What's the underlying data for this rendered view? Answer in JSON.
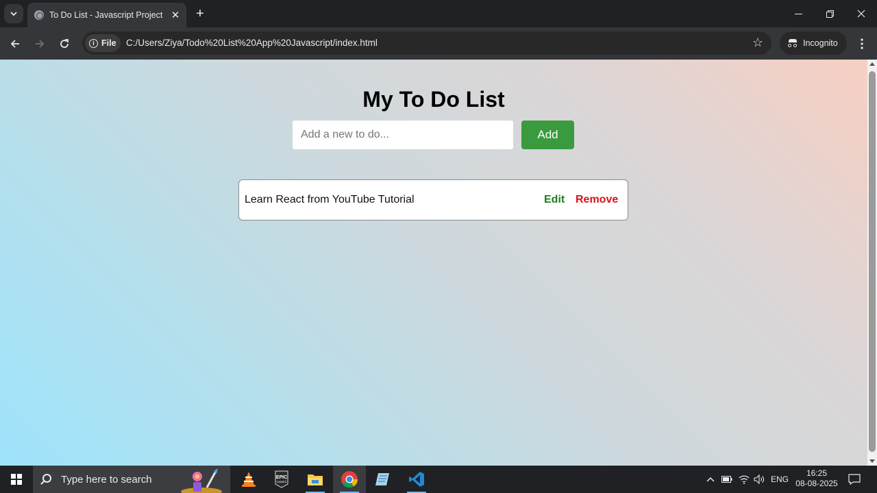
{
  "browser": {
    "tab_title": "To Do List - Javascript Project",
    "site_chip": "File",
    "url": "C:/Users/Ziya/Todo%20List%20App%20Javascript/index.html",
    "profile_label": "Incognito"
  },
  "app": {
    "title": "My To Do List",
    "input_placeholder": "Add a new to do...",
    "input_value": "",
    "add_label": "Add",
    "todos": [
      {
        "text": "Learn React from YouTube Tutorial",
        "edit_label": "Edit",
        "remove_label": "Remove"
      }
    ],
    "colors": {
      "add_button": "#3a9b3e",
      "edit": "#1c7d1c",
      "remove": "#d6131a"
    }
  },
  "taskbar": {
    "search_placeholder": "Type here to search",
    "language": "ENG",
    "time": "16:25",
    "date": "08-08-2025",
    "apps": [
      "vlc-icon",
      "epic-games-icon",
      "file-explorer-icon",
      "chrome-icon",
      "notepad-icon",
      "vscode-icon"
    ]
  }
}
